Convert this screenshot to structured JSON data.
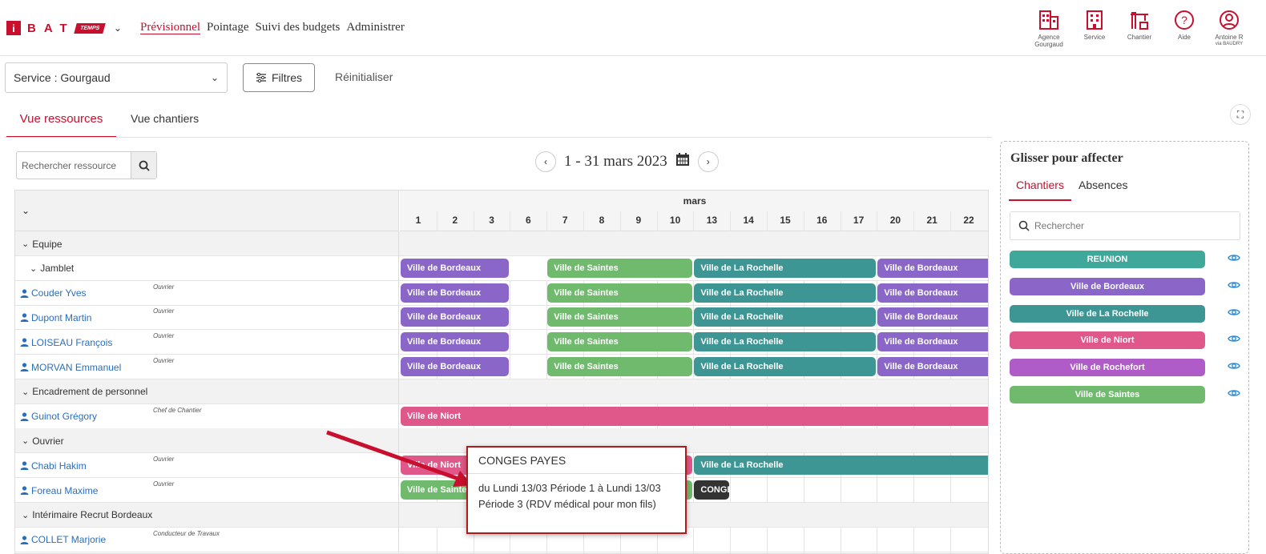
{
  "header": {
    "logo": {
      "i": "i",
      "bat": "BAT",
      "temps": "TEMPS"
    },
    "nav": [
      "Prévisionnel",
      "Pointage",
      "Suivi des budgets",
      "Administrer"
    ],
    "icons": [
      {
        "icon": "building-icon",
        "label": "Agence",
        "sub": "Gourgaud"
      },
      {
        "icon": "building-icon",
        "label": "Service",
        "sub": ""
      },
      {
        "icon": "crane-icon",
        "label": "Chantier",
        "sub": ""
      },
      {
        "icon": "help-icon",
        "label": "Aide",
        "sub": ""
      },
      {
        "icon": "user-icon",
        "label": "Antoine R",
        "sub": "via BAUDRY"
      }
    ]
  },
  "filters": {
    "service": "Service : Gourgaud",
    "filtres": "Filtres",
    "reset": "Réinitialiser"
  },
  "tabs": [
    "Vue ressources",
    "Vue chantiers"
  ],
  "search": {
    "placeholder": "Rechercher ressource"
  },
  "period": "1 - 31 mars 2023",
  "month": "mars",
  "days": [
    "1",
    "2",
    "3",
    "6",
    "7",
    "8",
    "9",
    "10",
    "13",
    "14",
    "15",
    "16",
    "17",
    "20",
    "21",
    "22"
  ],
  "rows": [
    {
      "type": "group",
      "label": "Equipe"
    },
    {
      "type": "subgroup",
      "label": "Jamblet"
    },
    {
      "type": "person",
      "name": "Couder Yves",
      "role": "Ouvrier"
    },
    {
      "type": "person",
      "name": "Dupont Martin",
      "role": "Ouvrier"
    },
    {
      "type": "person",
      "name": "LOISEAU François",
      "role": "Ouvrier"
    },
    {
      "type": "person",
      "name": "MORVAN Emmanuel",
      "role": "Ouvrier"
    },
    {
      "type": "group",
      "label": "Encadrement de personnel"
    },
    {
      "type": "person",
      "name": "Guinot Grégory",
      "role": "Chef de Chantier"
    },
    {
      "type": "group",
      "label": "Ouvrier"
    },
    {
      "type": "person",
      "name": "Chabi Hakim",
      "role": "Ouvrier"
    },
    {
      "type": "person",
      "name": "Foreau Maxime",
      "role": "Ouvrier"
    },
    {
      "type": "group",
      "label": "Intérimaire Recrut Bordeaux"
    },
    {
      "type": "person",
      "name": "COLLET Marjorie",
      "role": "Conducteur de Travaux"
    }
  ],
  "bars": {
    "bordeaux": "Ville de Bordeaux",
    "saintes": "Ville de Saintes",
    "rochelle": "Ville de La Rochelle",
    "niort": "Ville de Niort",
    "conges": "CONGES"
  },
  "panel": {
    "title": "Glisser pour affecter",
    "tabs": [
      "Chantiers",
      "Absences"
    ],
    "search": "Rechercher",
    "chips": [
      {
        "label": "REUNION",
        "color": "#3fa89a"
      },
      {
        "label": "Ville de Bordeaux",
        "color": "#8a66c9"
      },
      {
        "label": "Ville de La Rochelle",
        "color": "#3d9694"
      },
      {
        "label": "Ville de Niort",
        "color": "#e0578a"
      },
      {
        "label": "Ville de Rochefort",
        "color": "#b05cc8"
      },
      {
        "label": "Ville de Saintes",
        "color": "#6fba6c"
      }
    ]
  },
  "tooltip": {
    "title": "CONGES PAYES",
    "body": "du Lundi 13/03 Période 1 à Lundi 13/03 Période 3 (RDV médical pour mon fils)"
  },
  "colors": {
    "brand": "#c8102e",
    "bordeaux": "#8a66c9",
    "saintes": "#6fba6c",
    "rochelle": "#3d9694",
    "niort": "#e0578a",
    "conges": "#333333"
  }
}
